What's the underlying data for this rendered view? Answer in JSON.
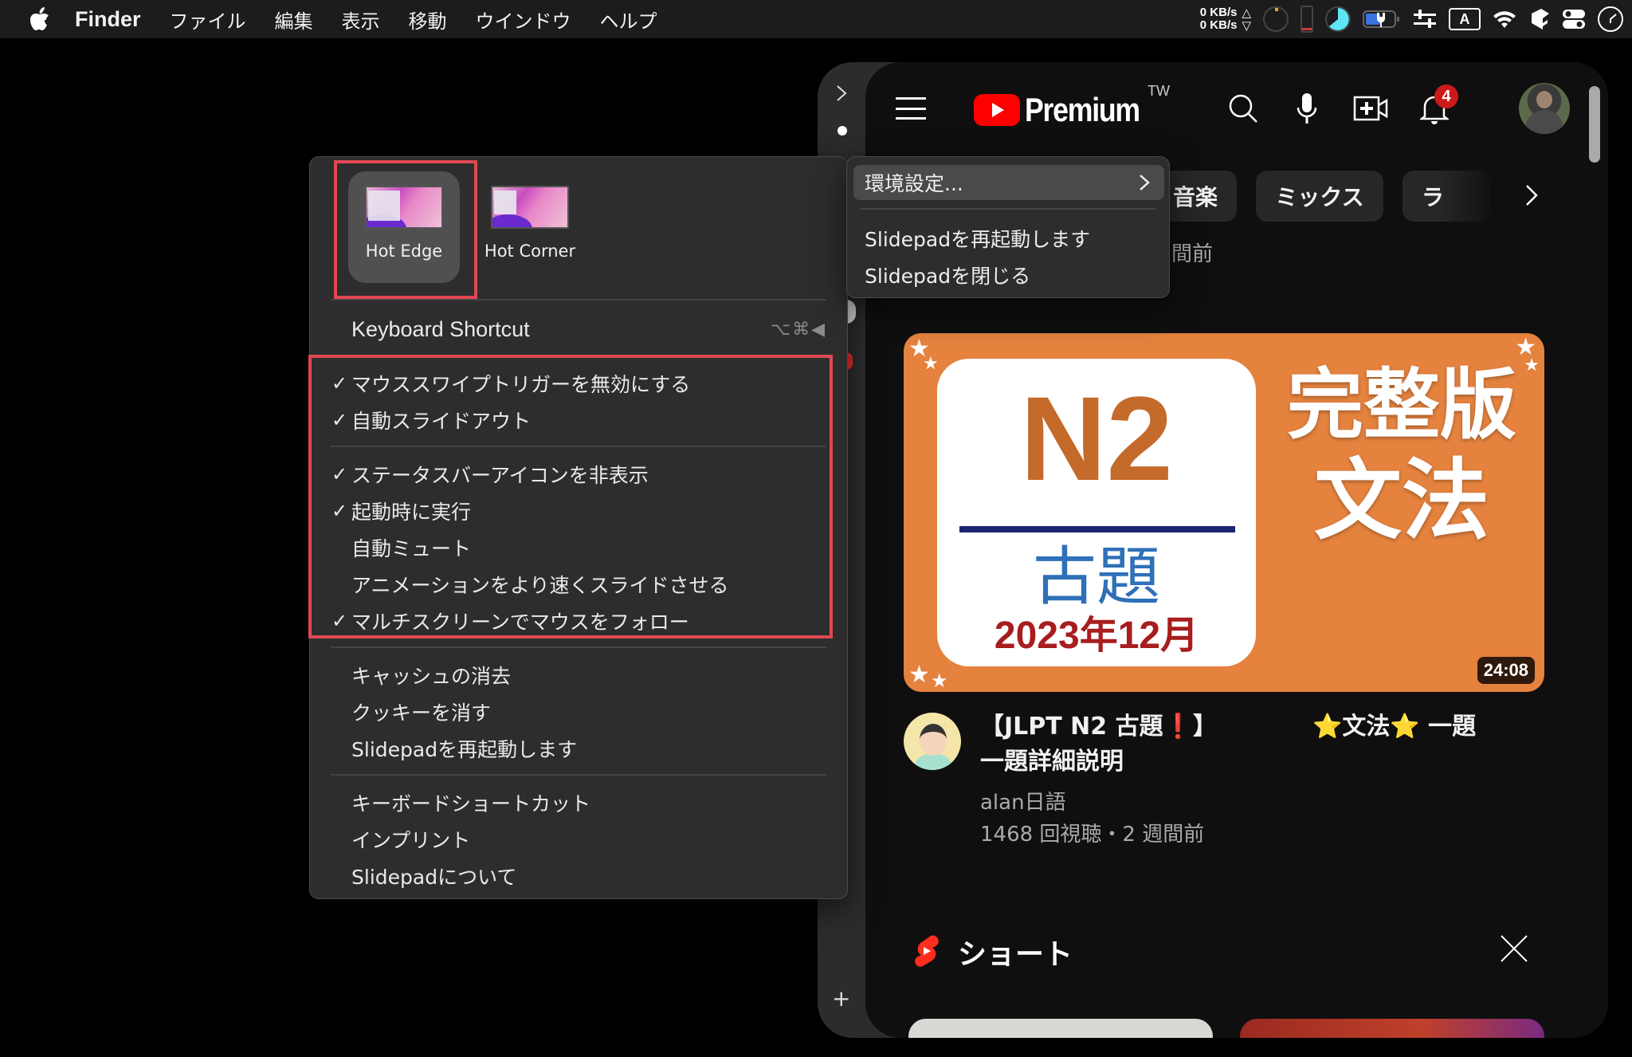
{
  "menubar": {
    "app_name": "Finder",
    "items": [
      "ファイル",
      "編集",
      "表示",
      "移動",
      "ウインドウ",
      "ヘルプ"
    ],
    "status": {
      "net_up": "0 KB/s",
      "net_down": "0 KB/s",
      "input_source": "A"
    }
  },
  "slidepad_menu": {
    "modes": [
      {
        "label": "Hot Edge",
        "selected": true
      },
      {
        "label": "Hot Corner",
        "selected": false
      }
    ],
    "keyboard_shortcut": {
      "label": "Keyboard Shortcut",
      "keys": "⌥⌘◀"
    },
    "options": [
      {
        "label": "マウススワイプトリガーを無効にする",
        "checked": true
      },
      {
        "label": "自動スライドアウト",
        "checked": true
      },
      {
        "label": "ステータスバーアイコンを非表示",
        "checked": true
      },
      {
        "label": "起動時に実行",
        "checked": true
      },
      {
        "label": "自動ミュート",
        "checked": false
      },
      {
        "label": "アニメーションをより速くスライドさせる",
        "checked": false
      },
      {
        "label": "マルチスクリーンでマウスをフォロー",
        "checked": true
      }
    ],
    "actions": [
      {
        "label": "キャッシュの消去"
      },
      {
        "label": "クッキーを消す"
      },
      {
        "label": "Slidepadを再起動します"
      }
    ],
    "info": [
      {
        "label": "キーボードショートカット"
      },
      {
        "label": "インプリント"
      },
      {
        "label": "Slidepadについて"
      }
    ],
    "check_glyph": "✓"
  },
  "secondary_menu": {
    "preferences": "環境設定...",
    "restart": "Slidepadを再起動します",
    "close": "Slidepadを閉じる"
  },
  "youtube": {
    "brand": "Premium",
    "region": "TW",
    "notification_count": "4",
    "chips": [
      "音楽",
      "ミックス",
      "ラ"
    ],
    "partial_meta": "間前",
    "video": {
      "thumbnail": {
        "level": "N2",
        "subtitle": "古題",
        "date": "2023年12月",
        "side_line1": "完整版",
        "side_line2": "文法"
      },
      "duration": "24:08",
      "title_part1": "【JLPT N2 古題",
      "title_excl": "❗",
      "title_part2": "】",
      "title_part3": "⭐文法⭐ 一題",
      "title_line2": "一題詳細説明",
      "channel": "alan日語",
      "stats": "1468 回視聴・2 週間前"
    },
    "shorts_label": "ショート"
  },
  "colors": {
    "highlight_box": "#e14852",
    "youtube_red": "#ff0000",
    "menu_bg": "#2d2d2d",
    "thumbnail_orange": "#e4823e"
  }
}
